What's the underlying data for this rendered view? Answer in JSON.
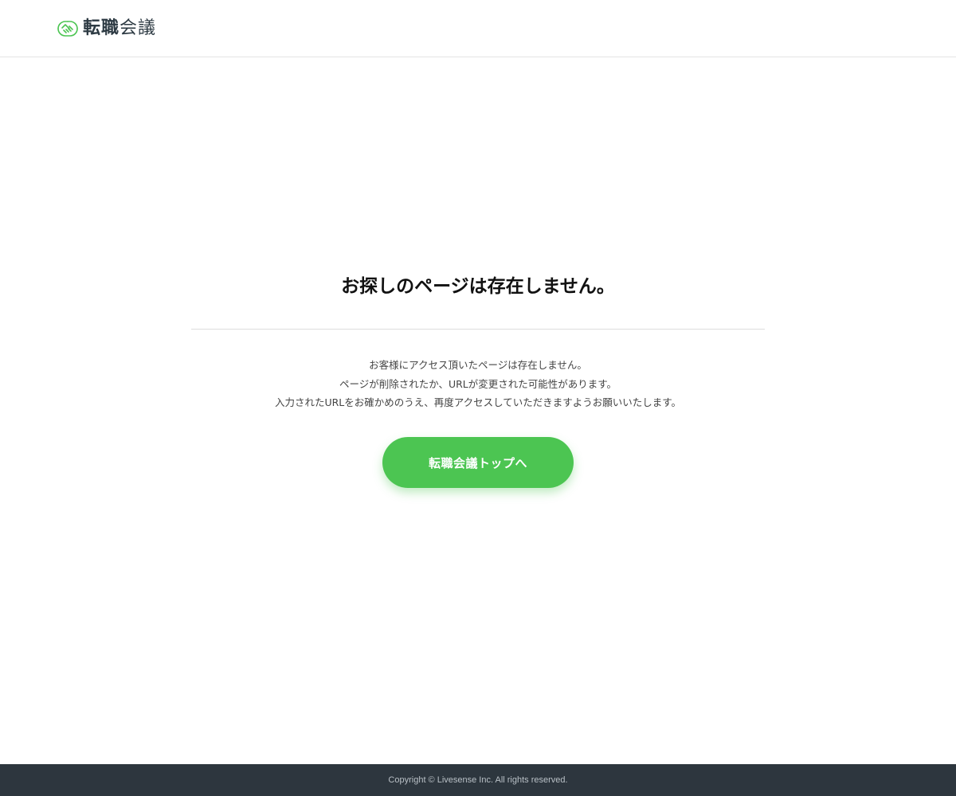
{
  "header": {
    "logo_icon": "handshake-icon",
    "logo_bold": "転職",
    "logo_light": "会議",
    "accent_color": "#4cc552"
  },
  "main": {
    "title": "お探しのページは存在しません。",
    "message_lines": [
      "お客様にアクセス頂いたページは存在しません。",
      "ページが削除されたか、URLが変更された可能性があります。",
      "入力されたURLをお確かめのうえ、再度アクセスしていただきますようお願いいたします。"
    ],
    "button_label": "転職会議トップへ"
  },
  "footer": {
    "copyright": "Copyright © Livesense Inc. All rights reserved."
  }
}
